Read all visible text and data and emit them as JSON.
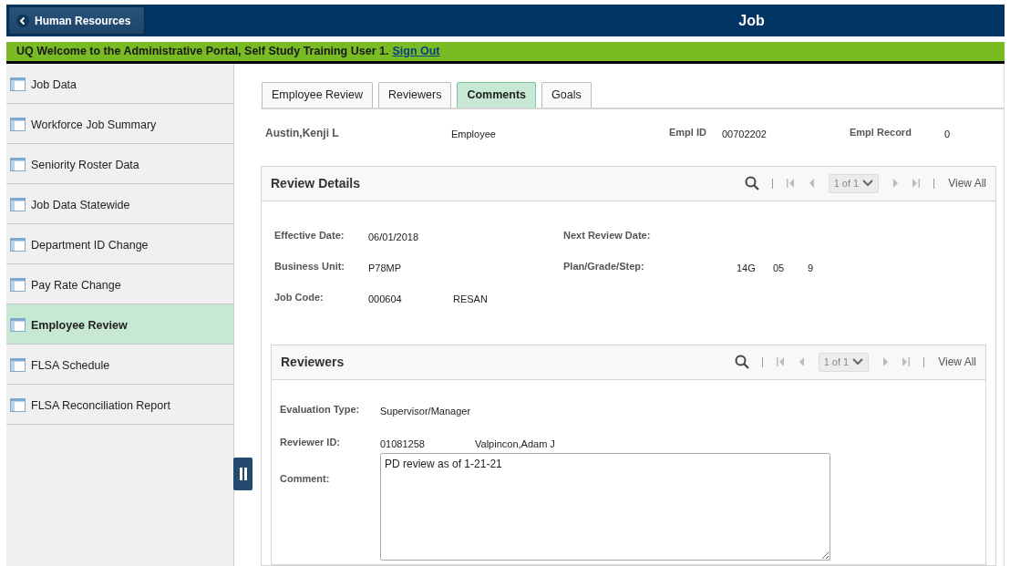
{
  "header": {
    "back_button": "Human Resources",
    "title": "Job"
  },
  "banner": {
    "text": "UQ Welcome to the Administrative Portal, Self Study Training User 1.",
    "link": "Sign Out"
  },
  "sidebar": {
    "items": [
      {
        "label": "Job Data",
        "selected": false
      },
      {
        "label": "Workforce Job Summary",
        "selected": false
      },
      {
        "label": "Seniority Roster Data",
        "selected": false
      },
      {
        "label": "Job Data Statewide",
        "selected": false
      },
      {
        "label": "Department ID Change",
        "selected": false
      },
      {
        "label": "Pay Rate Change",
        "selected": false
      },
      {
        "label": "Employee Review",
        "selected": true
      },
      {
        "label": "FLSA Schedule",
        "selected": false
      },
      {
        "label": "FLSA Reconciliation Report",
        "selected": false
      }
    ]
  },
  "tabs": [
    {
      "label": "Employee Review",
      "selected": false
    },
    {
      "label": "Reviewers",
      "selected": false
    },
    {
      "label": "Comments",
      "selected": true
    },
    {
      "label": "Goals",
      "selected": false
    }
  ],
  "employee": {
    "name": "Austin,Kenji L",
    "type": "Employee",
    "id_label": "Empl ID",
    "id_value": "00702202",
    "record_label": "Empl Record",
    "record_value": "0"
  },
  "review_details": {
    "title": "Review Details",
    "pager": {
      "page": "1 of 1",
      "view_all": "View All",
      "nav_disabled": true
    },
    "rows": [
      [
        {
          "label": "Effective Date:",
          "values": [
            "06/01/2018"
          ]
        },
        {
          "label": "Next Review Date:"
        }
      ],
      [
        {
          "label": "Business Unit:",
          "values": [
            "P78MP"
          ]
        },
        {
          "label": "Plan/Grade/Step:",
          "values": [
            "14G",
            "05",
            "9"
          ]
        }
      ],
      [
        {
          "label": "Job Code:",
          "values": [
            "000604",
            "RESAN"
          ]
        }
      ]
    ]
  },
  "reviewers": {
    "title": "Reviewers",
    "pager": {
      "page": "1 of 1",
      "view_all": "View All",
      "nav_disabled": true
    },
    "fields": [
      {
        "label": "Evaluation Type:",
        "values": [
          "Supervisor/Manager"
        ]
      },
      {
        "label": "Reviewer ID:",
        "values": [
          "01081258",
          "Valpincon,Adam J"
        ]
      }
    ],
    "comment": {
      "label": "Comment:",
      "value": "PD review as of 1-21-21"
    }
  }
}
